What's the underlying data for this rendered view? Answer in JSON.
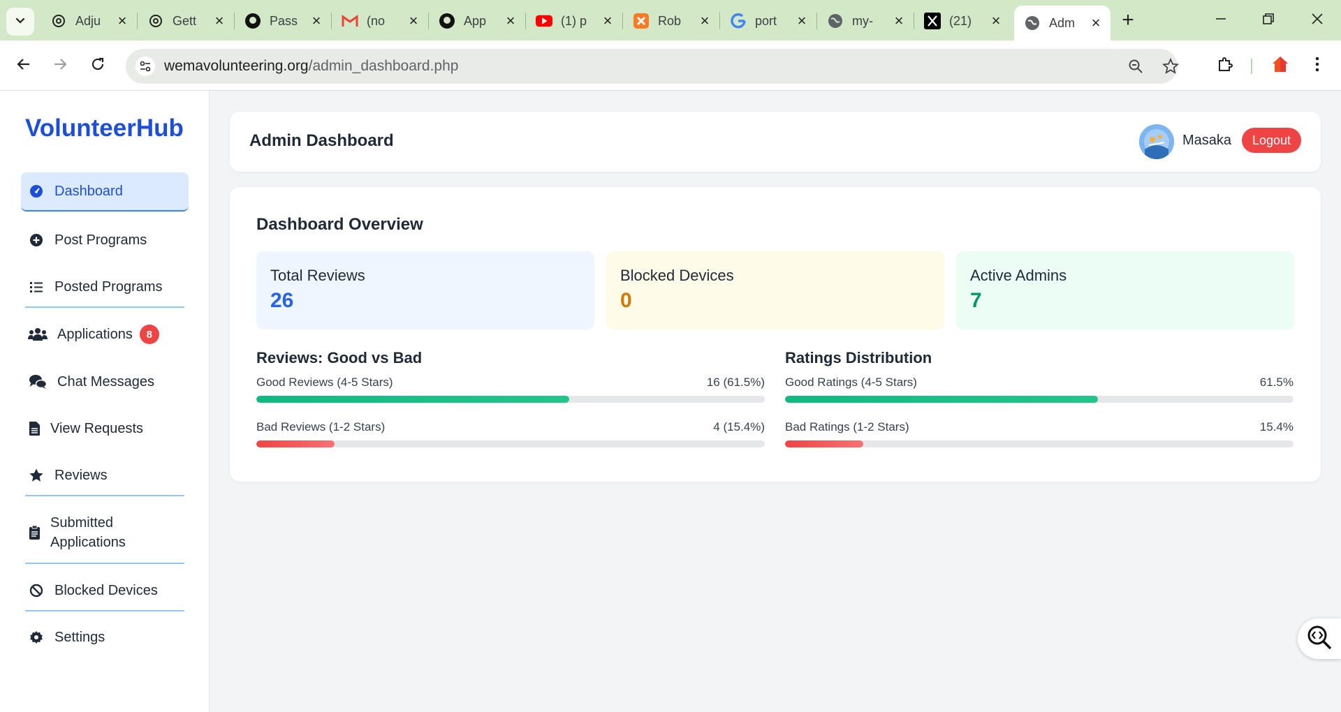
{
  "browser": {
    "tabs": [
      {
        "title": "Adju",
        "icon": "openai-icon"
      },
      {
        "title": "Gett",
        "icon": "openai-icon"
      },
      {
        "title": "Pass",
        "icon": "github-icon"
      },
      {
        "title": "(no",
        "icon": "gmail-icon"
      },
      {
        "title": "App",
        "icon": "github-icon"
      },
      {
        "title": "(1) p",
        "icon": "youtube-icon"
      },
      {
        "title": "Rob",
        "icon": "xampp-icon"
      },
      {
        "title": "port",
        "icon": "google-icon"
      },
      {
        "title": "my-",
        "icon": "globe-icon"
      },
      {
        "title": "(21)",
        "icon": "x-icon"
      },
      {
        "title": "Adm",
        "icon": "globe-icon"
      }
    ],
    "url_domain": "wemavolunteering.org",
    "url_path": "/admin_dashboard.php"
  },
  "sidebar": {
    "brand": "VolunteerHub",
    "items": [
      {
        "label": "Dashboard",
        "icon": "dashboard-gauge-icon"
      },
      {
        "label": "Post Programs",
        "icon": "plus-circle-icon"
      },
      {
        "label": "Posted Programs",
        "icon": "list-icon"
      },
      {
        "label": "Applications",
        "icon": "users-icon",
        "badge": "8"
      },
      {
        "label": "Chat Messages",
        "icon": "chat-bubbles-icon"
      },
      {
        "label": "View Requests",
        "icon": "document-icon"
      },
      {
        "label": "Reviews",
        "icon": "star-icon"
      },
      {
        "label": "Submitted Applications",
        "icon": "clipboard-icon"
      },
      {
        "label": "Blocked Devices",
        "icon": "ban-icon"
      },
      {
        "label": "Settings",
        "icon": "gear-icon"
      }
    ]
  },
  "header": {
    "title": "Admin Dashboard",
    "user_name": "Masaka",
    "logout_label": "Logout"
  },
  "overview": {
    "title": "Dashboard Overview",
    "stats": [
      {
        "label": "Total Reviews",
        "value": "26"
      },
      {
        "label": "Blocked Devices",
        "value": "0"
      },
      {
        "label": "Active Admins",
        "value": "7"
      }
    ],
    "reviews": {
      "title": "Reviews: Good vs Bad",
      "rows": [
        {
          "label": "Good Reviews (4-5 Stars)",
          "value_text": "16 (61.5%)",
          "percent": 61.5
        },
        {
          "label": "Bad Reviews (1-2 Stars)",
          "value_text": "4 (15.4%)",
          "percent": 15.4
        }
      ]
    },
    "ratings": {
      "title": "Ratings Distribution",
      "rows": [
        {
          "label": "Good Ratings (4-5 Stars)",
          "value_text": "61.5%",
          "percent": 61.5
        },
        {
          "label": "Bad Ratings (1-2 Stars)",
          "value_text": "15.4%",
          "percent": 15.4
        }
      ]
    }
  },
  "colors": {
    "brand": "#1d4ed8",
    "good": "#10b981",
    "bad": "#ef4444",
    "logout": "#ef4444",
    "tabstrip": "#d3e8c7"
  }
}
